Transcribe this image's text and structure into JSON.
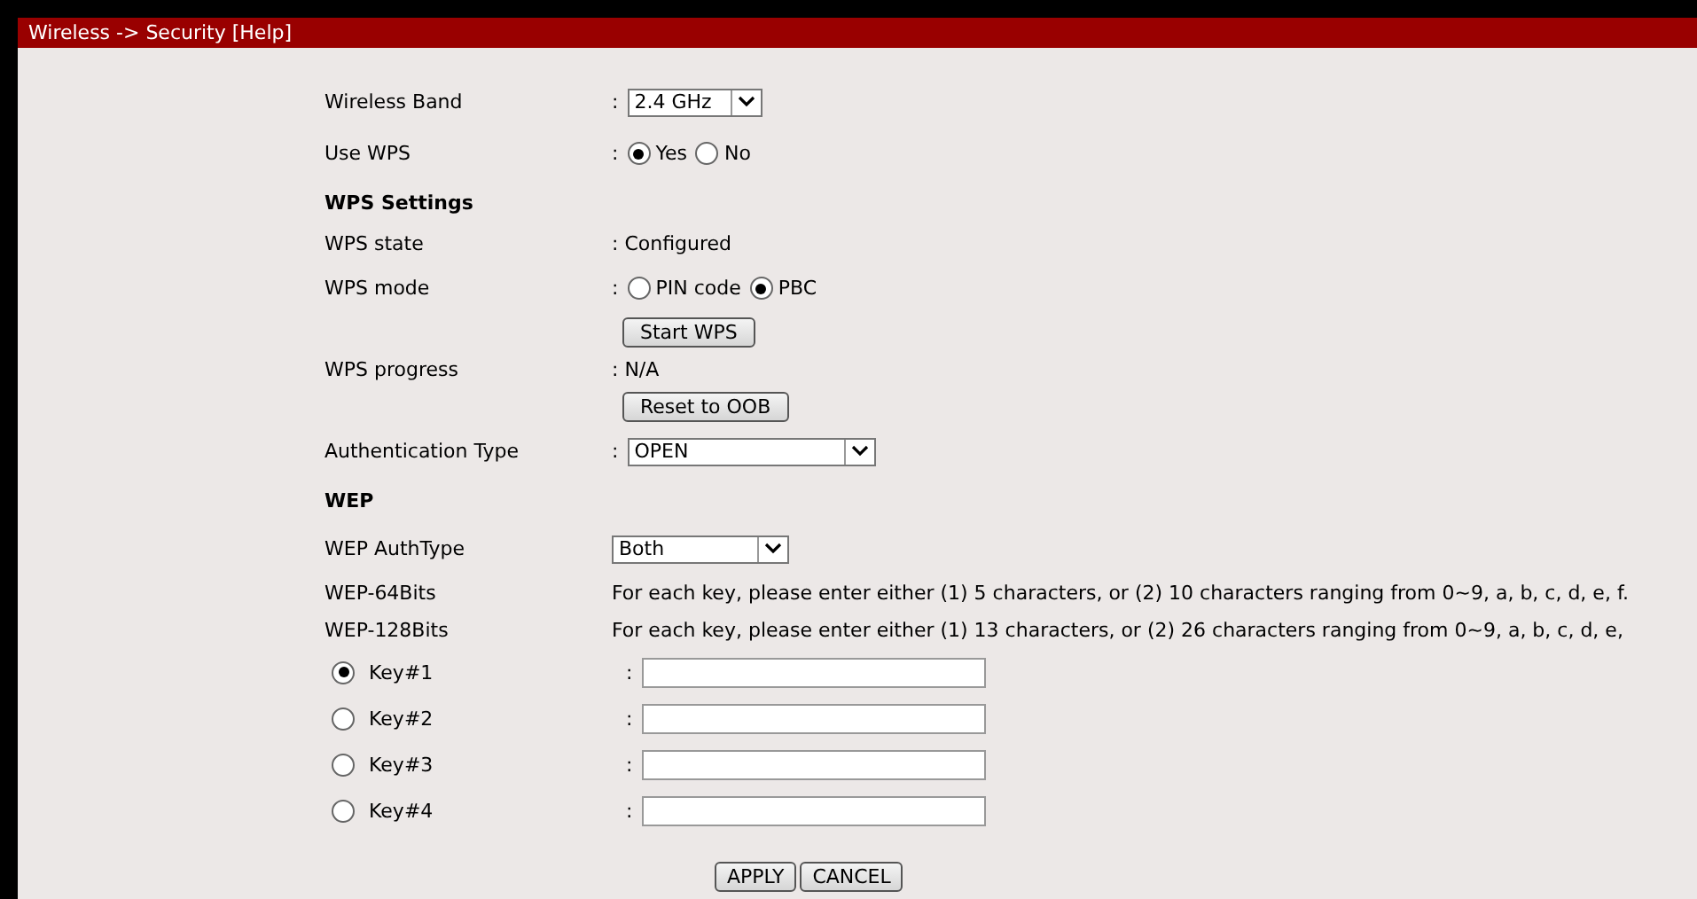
{
  "header": {
    "title": "Wireless -> Security [Help]"
  },
  "rows": [
    {
      "kind": "select",
      "label": "Wireless Band",
      "separator": ":",
      "value": "2.4 GHz"
    },
    {
      "kind": "radio",
      "label": "Use WPS",
      "separator": ":",
      "options": [
        {
          "label": "Yes",
          "selected": true
        },
        {
          "label": "No",
          "selected": false
        }
      ]
    },
    {
      "kind": "heading",
      "label": "WPS Settings"
    },
    {
      "kind": "text",
      "label": "WPS state",
      "value": ": Configured"
    },
    {
      "kind": "radio",
      "label": "WPS mode",
      "separator": ":",
      "options": [
        {
          "label": "PIN code",
          "selected": false
        },
        {
          "label": "PBC",
          "selected": true
        }
      ]
    },
    {
      "kind": "button",
      "button": "Start WPS"
    },
    {
      "kind": "text",
      "label": "WPS progress",
      "value": ": N/A"
    },
    {
      "kind": "button",
      "button": "Reset to OOB"
    },
    {
      "kind": "select",
      "label": "Authentication Type",
      "separator": ":",
      "value": "OPEN"
    },
    {
      "kind": "heading",
      "label": "WEP"
    },
    {
      "kind": "select",
      "label": "WEP AuthType",
      "value": "Both"
    },
    {
      "kind": "text",
      "label": "WEP-64Bits",
      "value": "For each key, please enter either (1) 5 characters, or (2) 10 characters ranging from 0~9, a, b, c, d, e, f."
    },
    {
      "kind": "text",
      "label": "WEP-128Bits",
      "value": "For each key, please enter either (1) 13 characters, or (2) 26 characters ranging from 0~9, a, b, c, d, e,"
    },
    {
      "kind": "key",
      "label": "Key#1",
      "selected": true,
      "separator": ":"
    },
    {
      "kind": "key",
      "label": "Key#2",
      "selected": false,
      "separator": ":"
    },
    {
      "kind": "key",
      "label": "Key#3",
      "selected": false,
      "separator": ":"
    },
    {
      "kind": "key",
      "label": "Key#4",
      "selected": false,
      "separator": ":"
    }
  ],
  "buttons": [
    "APPLY",
    "CANCEL"
  ]
}
